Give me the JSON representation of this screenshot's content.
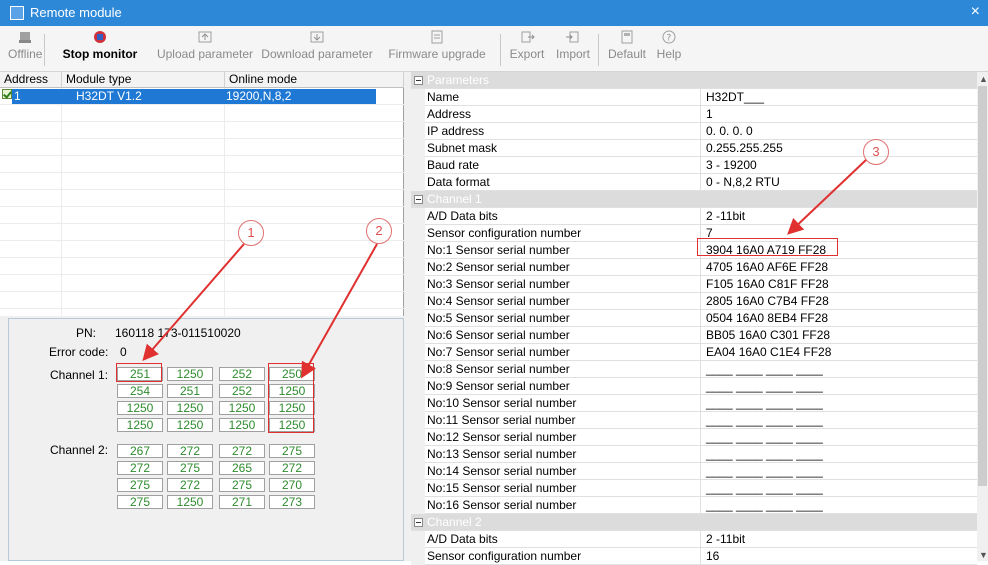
{
  "window": {
    "title": "Remote module",
    "close": "×"
  },
  "toolbar": {
    "offline": "Offline",
    "stop_monitor": "Stop monitor",
    "upload": "Upload parameter",
    "download": "Download parameter",
    "firmware": "Firmware upgrade",
    "export": "Export",
    "import": "Import",
    "default": "Default",
    "help": "Help"
  },
  "device_list": {
    "headers": [
      "Address",
      "Module type",
      "Online mode"
    ],
    "row": {
      "address": "1",
      "module_type": "H32DT V1.2",
      "online_mode": "19200,N,8,2"
    }
  },
  "status": {
    "pn_label": "PN:",
    "pn_value": "160118 173-011510020",
    "error_label": "Error code:",
    "error_value": "0",
    "channel1_label": "Channel 1:",
    "channel2_label": "Channel 2:",
    "channel1": [
      "251",
      "1250",
      "252",
      "250",
      "254",
      "251",
      "252",
      "1250",
      "1250",
      "1250",
      "1250",
      "1250",
      "1250",
      "1250",
      "1250",
      "1250"
    ],
    "channel2": [
      "267",
      "272",
      "272",
      "275",
      "272",
      "275",
      "265",
      "272",
      "275",
      "272",
      "275",
      "270",
      "275",
      "1250",
      "271",
      "273"
    ]
  },
  "properties": {
    "parameters_header": "Parameters",
    "name_k": "Name",
    "name_v": "H32DT___",
    "address_k": "Address",
    "address_v": "1",
    "ip_k": "IP address",
    "ip_v": "0. 0. 0. 0",
    "subnet_k": "Subnet mask",
    "subnet_v": "0.255.255.255",
    "baud_k": "Baud rate",
    "baud_v": "3 - 19200",
    "format_k": "Data format",
    "format_v": "0 - N,8,2 RTU",
    "ch1_header": "Channel 1",
    "ch1_ad_k": "A/D Data bits",
    "ch1_ad_v": "2 -11bit",
    "ch1_cfg_k": "Sensor configuration number",
    "ch1_cfg_v": "7",
    "sensors": [
      {
        "k": "No:1 Sensor serial number",
        "v": "3904 16A0 A719 FF28"
      },
      {
        "k": "No:2 Sensor serial number",
        "v": "4705 16A0 AF6E FF28"
      },
      {
        "k": "No:3 Sensor serial number",
        "v": "F105 16A0 C81F FF28"
      },
      {
        "k": "No:4 Sensor serial number",
        "v": "2805 16A0 C7B4 FF28"
      },
      {
        "k": "No:5 Sensor serial number",
        "v": "0504 16A0 8EB4 FF28"
      },
      {
        "k": "No:6 Sensor serial number",
        "v": "BB05 16A0 C301 FF28"
      },
      {
        "k": "No:7 Sensor serial number",
        "v": "EA04 16A0 C1E4 FF28"
      },
      {
        "k": "No:8 Sensor serial number",
        "v": "____ ____ ____ ____"
      },
      {
        "k": "No:9 Sensor serial number",
        "v": "____ ____ ____ ____"
      },
      {
        "k": "No:10 Sensor serial number",
        "v": "____ ____ ____ ____"
      },
      {
        "k": "No:11 Sensor serial number",
        "v": "____ ____ ____ ____"
      },
      {
        "k": "No:12 Sensor serial number",
        "v": "____ ____ ____ ____"
      },
      {
        "k": "No:13 Sensor serial number",
        "v": "____ ____ ____ ____"
      },
      {
        "k": "No:14 Sensor serial number",
        "v": "____ ____ ____ ____"
      },
      {
        "k": "No:15 Sensor serial number",
        "v": "____ ____ ____ ____"
      },
      {
        "k": "No:16 Sensor serial number",
        "v": "____ ____ ____ ____"
      }
    ],
    "ch2_header": "Channel 2",
    "ch2_ad_k": "A/D Data bits",
    "ch2_ad_v": "2 -11bit",
    "ch2_cfg_k": "Sensor configuration number",
    "ch2_cfg_v": "16"
  },
  "annotations": {
    "c1": "1",
    "c2": "2",
    "c3": "3"
  },
  "colors": {
    "accent": "#1e78d4",
    "value_green": "#2e8b2e",
    "annotation_red": "#e03030"
  }
}
